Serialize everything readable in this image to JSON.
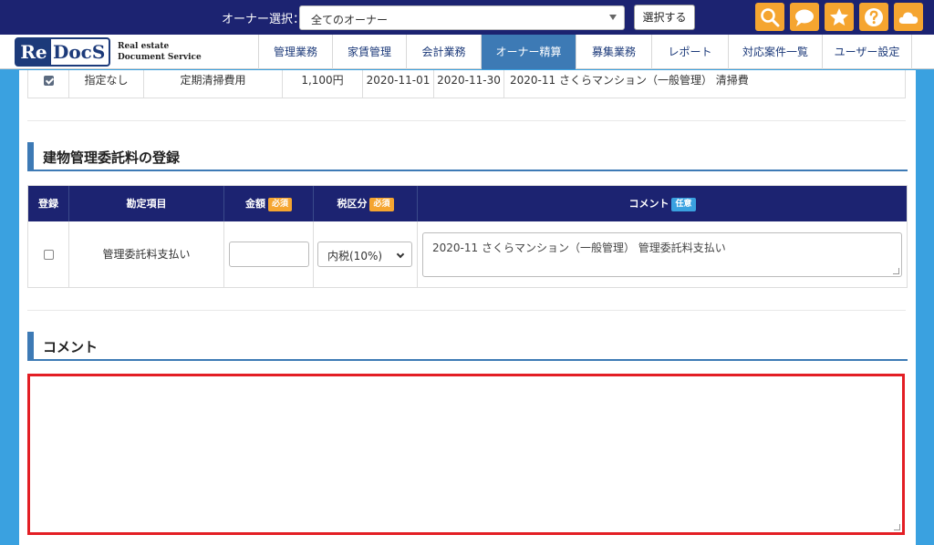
{
  "owner_bar": {
    "label": "オーナー選択：",
    "select_value": "全てのオーナー",
    "select_button": "選択する",
    "icons": [
      "search-icon",
      "chat-icon",
      "star-icon",
      "help-icon",
      "cloud-icon"
    ],
    "accent": "#f5a530",
    "background": "#1c2371"
  },
  "logo": {
    "re": "Re",
    "docs": "DocS",
    "line1": "Real estate",
    "line2": "Document Service"
  },
  "nav": {
    "items": [
      {
        "label": "管理業務",
        "active": false
      },
      {
        "label": "家賃管理",
        "active": false
      },
      {
        "label": "会計業務",
        "active": false
      },
      {
        "label": "オーナー精算",
        "active": true
      },
      {
        "label": "募集業務",
        "active": false
      },
      {
        "label": "レポート",
        "active": false
      },
      {
        "label": "対応案件一覧",
        "active": false
      },
      {
        "label": "ユーザー設定",
        "active": false
      }
    ]
  },
  "prev_row": {
    "checked": true,
    "designation": "指定なし",
    "item": "定期清掃費用",
    "amount": "1,100円",
    "start": "2020-11-01",
    "end": "2020-11-30",
    "comment": "2020-11 さくらマンション（一般管理） 清掃費"
  },
  "building_section": {
    "title": "建物管理委託料の登録",
    "headers": {
      "register": "登録",
      "account": "勘定項目",
      "amount": "金額",
      "tax": "税区分",
      "comment": "コメント"
    },
    "required_badge": "必須",
    "optional_badge": "任意",
    "row": {
      "checked": false,
      "account": "管理委託料支払い",
      "amount_value": "",
      "tax_value": "内税(10%)",
      "comment": "2020-11 さくらマンション（一般管理） 管理委託料支払い"
    }
  },
  "comment_section": {
    "title": "コメント",
    "value": ""
  }
}
